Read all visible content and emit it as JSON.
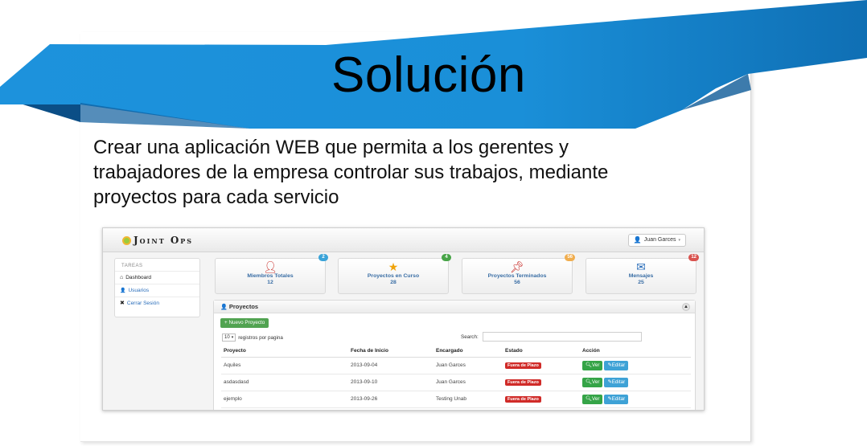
{
  "slide": {
    "title": "Solución",
    "body": "Crear una aplicación WEB que permita a los gerentes y trabajadores de la empresa controlar sus trabajos, mediante proyectos para cada servicio",
    "banner_color": "#1a8fd8"
  },
  "app": {
    "logo": "Joint Ops",
    "user_menu": "Juan Garces",
    "sidebar": {
      "heading": "TAREAS",
      "items": [
        {
          "label": "Dashboard",
          "icon": "home-icon"
        },
        {
          "label": "Usuarios",
          "icon": "user-icon"
        },
        {
          "label": "Cerrar Sesión",
          "icon": "close-icon"
        }
      ]
    },
    "stats": [
      {
        "label": "Miembros Totales",
        "value": "12",
        "badge": "2",
        "badge_color": "#3aa3d8",
        "icon": "user-icon",
        "icon_color": "#c9302c"
      },
      {
        "label": "Proyectos en Curso",
        "value": "28",
        "badge": "4",
        "badge_color": "#47a447",
        "icon": "star-icon",
        "icon_color": "#f0a30a"
      },
      {
        "label": "Proyectos Terminados",
        "value": "56",
        "badge": "56",
        "badge_color": "#f0ad4e",
        "icon": "pin-icon",
        "icon_color": "#c9302c"
      },
      {
        "label": "Mensajes",
        "value": "25",
        "badge": "12",
        "badge_color": "#d9534f",
        "icon": "envelope-icon",
        "icon_color": "#2a6ebb"
      }
    ],
    "panel": {
      "title": "Proyectos",
      "new_button": "Nuevo Proyecto",
      "page_length": "10",
      "page_length_suffix": "registros por pagina",
      "search_label": "Search:",
      "columns": [
        "Proyecto",
        "Fecha de Inicio",
        "Encargado",
        "Estado",
        "Acción"
      ],
      "rows": [
        {
          "proyecto": "Aquiles",
          "fecha": "2013-09-04",
          "encargado": "Juan Garces",
          "estado": "Fuera de Plazo"
        },
        {
          "proyecto": "asdasdasd",
          "fecha": "2013-09-10",
          "encargado": "Juan Garces",
          "estado": "Fuera de Plazo"
        },
        {
          "proyecto": "ejemplo",
          "fecha": "2013-09-26",
          "encargado": "Testing Unab",
          "estado": "Fuera de Plazo"
        }
      ],
      "ver_label": "Ver",
      "edit_label": "Editar"
    }
  }
}
